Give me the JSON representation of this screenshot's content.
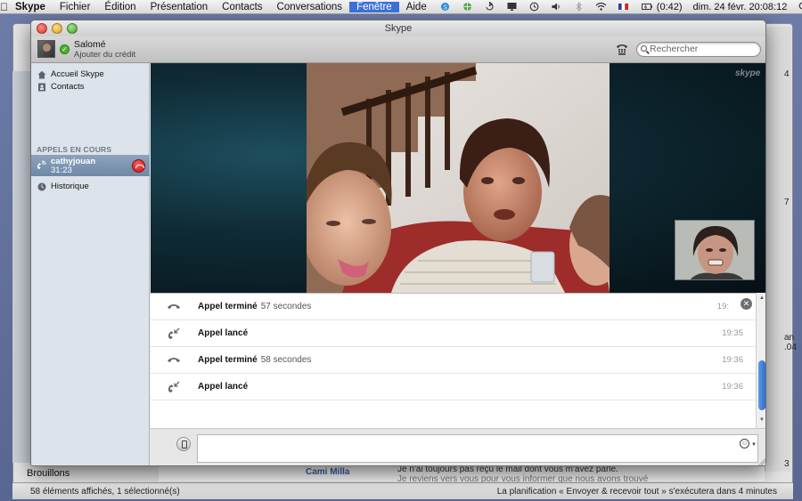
{
  "menubar": {
    "app": "Skype",
    "items": [
      "Fichier",
      "Édition",
      "Présentation",
      "Contacts",
      "Conversations",
      "Fenêtre",
      "Aide"
    ],
    "battery": "(0:42)",
    "clock": "dim. 24 févr.  20:08:12"
  },
  "background_mail": {
    "drafts_label": "Brouillons",
    "status_left": "58 éléments affichés, 1 sélectionné(s)",
    "status_right": "La planification « Envoyer & recevoir tout » s'exécutera dans 4 minutes",
    "sender": "Cami Milla",
    "preview_line": "Je n'ai toujours pas reçu le mail dont vous m'avez parlé.",
    "preview_line2": "Je reviens vers vous pour vous informer que nous avons trouvé",
    "edge_text": [
      "4",
      "7",
      "an",
      ".04",
      "3"
    ]
  },
  "skype": {
    "window_title": "Skype",
    "user": {
      "name": "Salomé",
      "credit": "Ajouter du crédit"
    },
    "search_placeholder": "Rechercher",
    "sidebar": {
      "home": "Accueil Skype",
      "contacts": "Contacts",
      "section_calls": "APPELS EN COURS",
      "active_call": {
        "name": "cathyjouan",
        "duration": "31:23"
      },
      "history": "Historique"
    },
    "watermark": "skype",
    "history_rows": [
      {
        "type": "ended",
        "label": "Appel terminé",
        "detail": "57 secondes",
        "time": "19:"
      },
      {
        "type": "placed",
        "label": "Appel lancé",
        "detail": "",
        "time": "19:35"
      },
      {
        "type": "ended",
        "label": "Appel terminé",
        "detail": "58 secondes",
        "time": "19:36"
      },
      {
        "type": "placed",
        "label": "Appel lancé",
        "detail": "",
        "time": "19:36"
      }
    ],
    "message_value": "",
    "colors": {
      "sidebar_selected": "#7890ad",
      "hangup": "#d91f1f",
      "scroll_thumb": "#3c7fd6"
    }
  }
}
